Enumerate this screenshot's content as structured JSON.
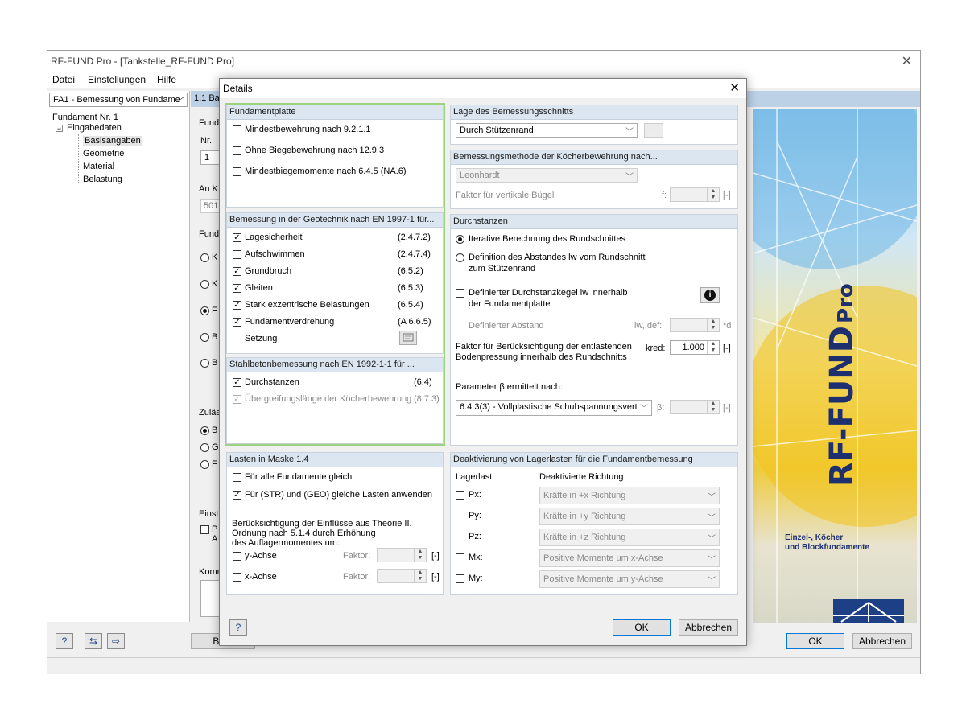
{
  "window": {
    "title": "RF-FUND Pro - [Tankstelle_RF-FUND Pro]",
    "close_glyph": "✕"
  },
  "menu": [
    "Datei",
    "Einstellungen",
    "Hilfe"
  ],
  "left": {
    "case_combo": "FA1 - Bemessung von Fundame",
    "tree": {
      "root": "Fundament Nr. 1",
      "group": "Eingabedaten",
      "items": [
        "Basisangaben",
        "Geometrie",
        "Material",
        "Belastung"
      ]
    }
  },
  "mask": {
    "header": "1.1 Ba",
    "partial_labels": [
      "Fund",
      "Nr.:",
      "1",
      "An K",
      "501",
      "Fund",
      "K",
      "K",
      "F",
      "B",
      "B",
      "Zuläs",
      "B",
      "G",
      "F",
      "Einst",
      "P",
      "A",
      "Komm"
    ],
    "bottom_partial": "Bere"
  },
  "splash": {
    "product": "RF-FUND Pro",
    "product_main": "RF-FUND",
    "product_suffix": "Pro",
    "subtitle_1": "Einzel-, Köcher",
    "subtitle_2": "und Blockfundamente"
  },
  "main_buttons": {
    "ok": "OK",
    "cancel": "Abbrechen"
  },
  "dialog": {
    "title": "Details",
    "close_glyph": "✕",
    "fundamentplatte": {
      "title": "Fundamentplatte",
      "items": [
        {
          "label": "Mindestbewehrung nach 9.2.1.1",
          "checked": false
        },
        {
          "label": "Ohne Biegebewehrung nach 12.9.3",
          "checked": false
        },
        {
          "label": "Mindestbiegemomente nach 6.4.5 (NA.6)",
          "checked": false
        }
      ]
    },
    "geotechnik": {
      "title": "Bemessung in der Geotechnik nach EN 1997-1 für...",
      "items": [
        {
          "label": "Lagesicherheit",
          "ref": "(2.4.7.2)",
          "checked": true
        },
        {
          "label": "Aufschwimmen",
          "ref": "(2.4.7.4)",
          "checked": false
        },
        {
          "label": "Grundbruch",
          "ref": "(6.5.2)",
          "checked": true
        },
        {
          "label": "Gleiten",
          "ref": "(6.5.3)",
          "checked": true
        },
        {
          "label": "Stark exzentrische Belastungen",
          "ref": "(6.5.4)",
          "checked": true
        },
        {
          "label": "Fundamentverdrehung",
          "ref": "(A 6.6.5)",
          "checked": true
        },
        {
          "label": "Setzung",
          "ref": "",
          "checked": false
        }
      ]
    },
    "stahlbeton": {
      "title": "Stahlbetonbemessung nach EN 1992-1-1 für ...",
      "items": [
        {
          "label": "Durchstanzen",
          "ref": "(6.4)",
          "checked": true
        },
        {
          "label": "Übergreifungslänge der Köcherbewehrung",
          "ref": "(8.7.3)",
          "checked": true,
          "disabled": true
        }
      ]
    },
    "lage": {
      "title": "Lage des Bemessungsschnitts",
      "value": "Durch Stützenrand",
      "more": "..."
    },
    "methode": {
      "title": "Bemessungsmethode der Köcherbewehrung nach...",
      "value": "Leonhardt",
      "faktor_label": "Faktor für vertikale Bügel",
      "f_label": "f:",
      "unit": "[-]"
    },
    "durchstanzen": {
      "title": "Durchstanzen",
      "radio1": "Iterative Berechnung des Rundschnittes",
      "radio2_a": "Definition des Abstandes lw vom Rundschnitt",
      "radio2_b": "zum Stützenrand",
      "kegel_a": "Definierter Durchstanzkegel lw innerhalb",
      "kegel_b": "der Fundamentplatte",
      "info": "i",
      "abstand_label": "Definierter Abstand",
      "abstand_sym": "lw, def:",
      "abstand_unit": "*d",
      "faktor_a": "Faktor für Berücksichtigung der entlastenden",
      "faktor_b": "Bodenpressung innerhalb des Rundschnitts",
      "kred_sym": "kred:",
      "kred_value": "1.000",
      "kred_unit": "[-]",
      "param_label": "Parameter β ermittelt nach:",
      "param_value": "6.4.3(3) - Vollplastische Schubspannungsverte",
      "beta_sym": "β:",
      "beta_unit": "[-]"
    },
    "lasten": {
      "title": "Lasten in Maske 1.4",
      "item1": {
        "label": "Für alle Fundamente gleich",
        "checked": false
      },
      "item2": {
        "label": "Für (STR) und (GEO) gleiche Lasten anwenden",
        "checked": true
      },
      "theorie_1": "Berücksichtigung der Einflüsse aus Theorie II.",
      "theorie_2": "Ordnung nach 5.1.4 durch Erhöhung",
      "theorie_3": "des Auflagermomentes um:",
      "yachse": "y-Achse",
      "xachse": "x-Achse",
      "faktor": "Faktor:",
      "unit": "[-]"
    },
    "deaktivierung": {
      "title": "Deaktivierung von Lagerlasten für die Fundamentbemessung",
      "col1": "Lagerlast",
      "col2": "Deaktivierte Richtung",
      "rows": [
        {
          "sym": "Px:",
          "value": "Kräfte in +x Richtung"
        },
        {
          "sym": "Py:",
          "value": "Kräfte in +y Richtung"
        },
        {
          "sym": "Pz:",
          "value": "Kräfte in +z Richtung"
        },
        {
          "sym": "Mx:",
          "value": "Positive Momente um x-Achse"
        },
        {
          "sym": "My:",
          "value": "Positive Momente um y-Achse"
        }
      ]
    },
    "buttons": {
      "ok": "OK",
      "cancel": "Abbrechen",
      "help": "?"
    }
  }
}
